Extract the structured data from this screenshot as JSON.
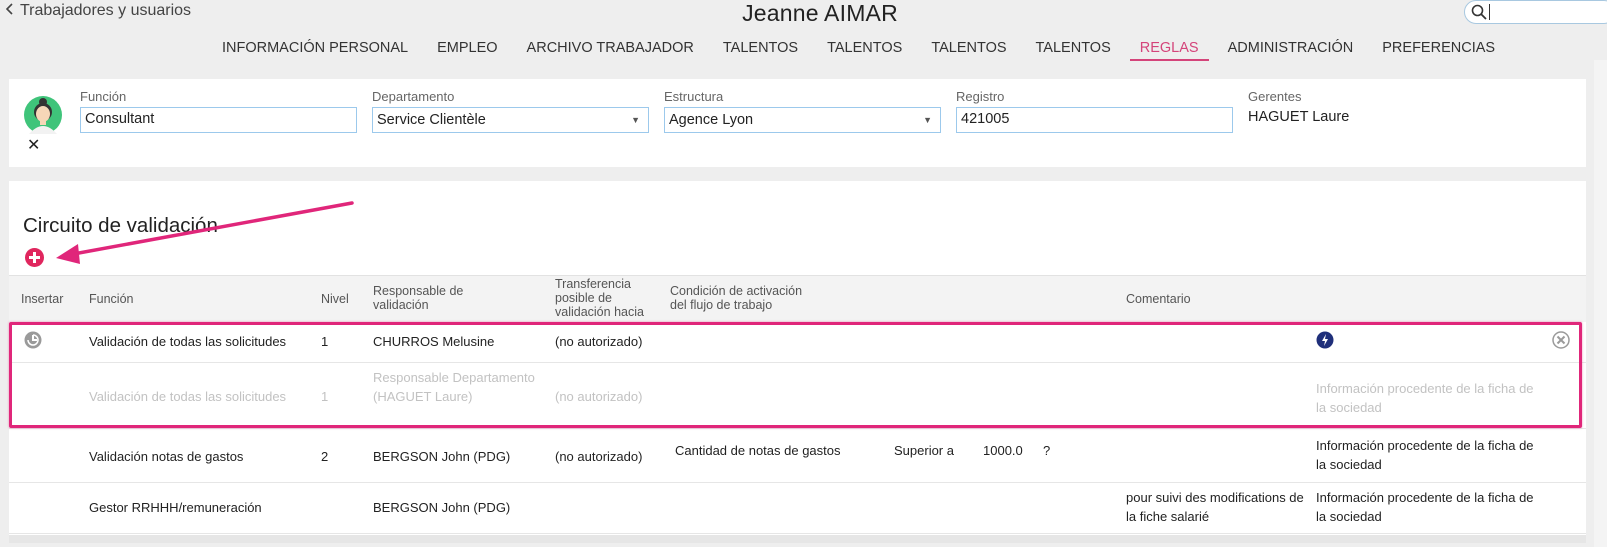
{
  "header": {
    "back_label": "Trabajadores y usuarios",
    "title": "Jeanne AIMAR"
  },
  "tabs": [
    {
      "label": "INFORMACIÓN PERSONAL"
    },
    {
      "label": "EMPLEO"
    },
    {
      "label": "ARCHIVO TRABAJADOR"
    },
    {
      "label": "TALENTOS"
    },
    {
      "label": "TALENTOS"
    },
    {
      "label": "TALENTOS"
    },
    {
      "label": "TALENTOS"
    },
    {
      "label": "REGLAS",
      "active": true
    },
    {
      "label": "ADMINISTRACIÓN"
    },
    {
      "label": "PREFERENCIAS"
    }
  ],
  "employee": {
    "funcion_label": "Función",
    "funcion_value": "Consultant",
    "departamento_label": "Departamento",
    "departamento_value": "Service Clientèle",
    "estructura_label": "Estructura",
    "estructura_value": "Agence Lyon",
    "registro_label": "Registro",
    "registro_value": "421005",
    "gerentes_label": "Gerentes",
    "gerentes_value": "HAGUET Laure"
  },
  "circuit": {
    "title": "Circuito de validación",
    "columns": {
      "insertar": "Insertar",
      "funcion": "Función",
      "nivel": "Nivel",
      "responsable": "Responsable de validación",
      "transferencia": "Transferencia posible de validación hacia",
      "condicion": "Condición de activación del flujo de trabajo",
      "comentario": "Comentario"
    },
    "rows": [
      {
        "funcion": "Validación de todas las solicitudes",
        "nivel": "1",
        "responsable": "CHURROS Melusine",
        "transferencia": "(no autorizado)"
      },
      {
        "funcion": "Validación de todas las solicitudes",
        "nivel": "1",
        "responsable": "Responsable Departamento (HAGUET Laure)",
        "transferencia": "(no autorizado)",
        "info": "Información procedente de la ficha de la sociedad"
      },
      {
        "funcion": "Validación notas de gastos",
        "nivel": "2",
        "responsable": "BERGSON John (PDG)",
        "transferencia": "(no autorizado)",
        "cond_field": "Cantidad de notas de gastos",
        "cond_operator": "Superior a",
        "cond_value": "1000.0",
        "cond_help": "?",
        "info": "Información procedente de la ficha de la sociedad"
      },
      {
        "funcion": "Gestor RRHHH/remuneración",
        "responsable": "BERGSON John (PDG)",
        "comentario": "pour suivi des modifications de la fiche salarié",
        "info": "Información procedente de la ficha de la sociedad"
      }
    ]
  },
  "colors": {
    "accent": "#d4447a",
    "annotation": "#e0267a",
    "input_border": "#9cc9ec"
  }
}
